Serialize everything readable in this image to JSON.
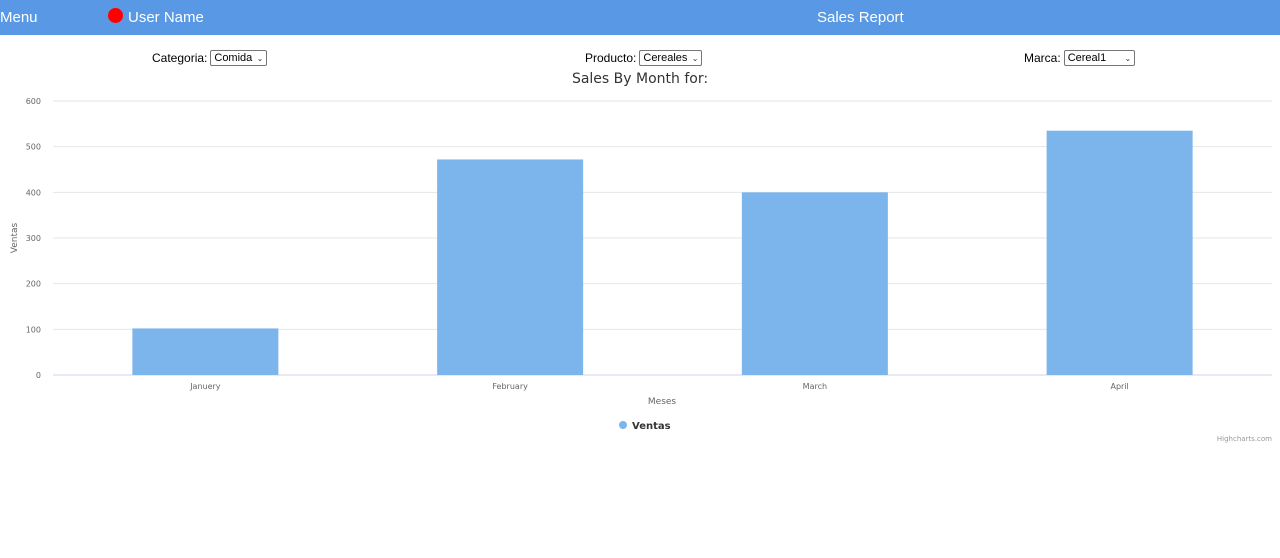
{
  "topbar": {
    "menu_label": "Menu",
    "user_name": "User Name",
    "title": "Sales Report",
    "bar_color": "#5898e4",
    "status_dot_color": "#ff0000"
  },
  "filters": {
    "categoria": {
      "label": "Categoria:",
      "value": "Comida"
    },
    "producto": {
      "label": "Producto:",
      "value": "Cereales"
    },
    "marca": {
      "label": "Marca:",
      "value": "Cereal1"
    }
  },
  "chart_data": {
    "type": "bar",
    "title": "Sales By Month for:",
    "categories": [
      "Januery",
      "February",
      "March",
      "April"
    ],
    "series": [
      {
        "name": "Ventas",
        "values": [
          102,
          472,
          400,
          535
        ],
        "color": "#7cb5ec"
      }
    ],
    "xlabel": "Meses",
    "ylabel": "Ventas",
    "ylim": [
      0,
      600
    ],
    "yticks": [
      0,
      100,
      200,
      300,
      400,
      500,
      600
    ],
    "grid": true,
    "legend": "bottom-center",
    "credits": "Highcharts.com"
  }
}
